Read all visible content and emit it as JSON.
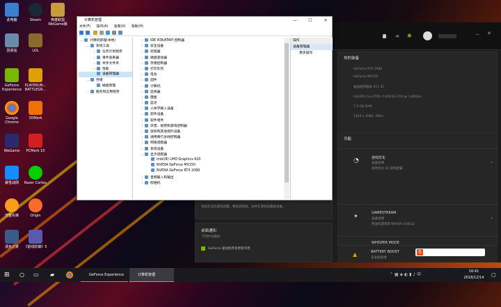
{
  "desktop": {
    "icons": [
      "此电脑",
      "Steam",
      "英雄联盟 WeGame版",
      "回收站",
      "LOL",
      "GeForce Experience",
      "PLAYERUN... BATTLEGR...",
      "Google Chrome",
      "3DMark",
      "WeGame",
      "PCMark 10",
      "暴雪战网",
      "Razer Cortex",
      "守望先锋",
      "Origin",
      "漫步之家",
      "《前线防御》5"
    ]
  },
  "gfe": {
    "section_hot": "热的装备",
    "hw": [
      "GeForce RTX 2080",
      "GeForce MX150",
      "驱动程序版本 417.35",
      "Intel(R) Core(TM) i7-8565U CPU @ 1.80GHz",
      "7.9 GB RAM",
      "1920 x 1080, 59Hz"
    ],
    "section_features": "功能",
    "features": [
      {
        "title": "游戏优化",
        "l1": "准备就绪",
        "l2": "提供优化 42 游戏配置"
      },
      {
        "title": "GAMESTREAM",
        "l1": "准备就绪",
        "l2": "传送的游戏到 NVIDIA SHIELD"
      },
      {
        "title": "WHISPER MODE",
        "l1": "未准备就绪",
        "l2": "请打开，让播放电脑的笔记本电脑更安静地运行。"
      },
      {
        "title": "BATTERY BOOST",
        "l1": "未准备就绪",
        "l2": ""
      }
    ],
    "desc_line": "轻松在您的游戏前瞻，释放游戏帧，合并在游戏前瞻素材素。",
    "notify_title": "桌面通知",
    "notify_sub": "下列时间通知：",
    "notify_check": "GeForce 驱动程序有更新可用"
  },
  "dm": {
    "title": "计算机管理",
    "menu": [
      "文件(F)",
      "操作(A)",
      "查看(V)",
      "帮助(H)"
    ],
    "left": [
      {
        "t": "计算机管理(本地)",
        "lv": 0,
        "ex": "⌄"
      },
      {
        "t": "系统工具",
        "lv": 1,
        "ex": "⌄"
      },
      {
        "t": "任务计划程序",
        "lv": 2,
        "ex": "›"
      },
      {
        "t": "事件查看器",
        "lv": 2,
        "ex": "›"
      },
      {
        "t": "共享文件夹",
        "lv": 2,
        "ex": "›"
      },
      {
        "t": "性能",
        "lv": 2,
        "ex": "›"
      },
      {
        "t": "设备管理器",
        "lv": 2,
        "ex": "",
        "sel": true
      },
      {
        "t": "存储",
        "lv": 1,
        "ex": "⌄"
      },
      {
        "t": "磁盘管理",
        "lv": 2,
        "ex": ""
      },
      {
        "t": "服务和应用程序",
        "lv": 1,
        "ex": "›"
      }
    ],
    "tree": [
      {
        "t": "IDE ATA/ATAPI 控制器",
        "lv": 0,
        "ex": "›"
      },
      {
        "t": "安全设备",
        "lv": 0,
        "ex": "›"
      },
      {
        "t": "处理器",
        "lv": 0,
        "ex": "›"
      },
      {
        "t": "磁盘驱动器",
        "lv": 0,
        "ex": "›"
      },
      {
        "t": "存储控制器",
        "lv": 0,
        "ex": "›"
      },
      {
        "t": "打印队列",
        "lv": 0,
        "ex": "›"
      },
      {
        "t": "电池",
        "lv": 0,
        "ex": "›"
      },
      {
        "t": "固件",
        "lv": 0,
        "ex": "›"
      },
      {
        "t": "计算机",
        "lv": 0,
        "ex": "›"
      },
      {
        "t": "监视器",
        "lv": 0,
        "ex": "›"
      },
      {
        "t": "键盘",
        "lv": 0,
        "ex": "›"
      },
      {
        "t": "蓝牙",
        "lv": 0,
        "ex": "›"
      },
      {
        "t": "人体学输入设备",
        "lv": 0,
        "ex": "›"
      },
      {
        "t": "软件设备",
        "lv": 0,
        "ex": "›"
      },
      {
        "t": "软件组件",
        "lv": 0,
        "ex": "›"
      },
      {
        "t": "声音、视频和游戏控制器",
        "lv": 0,
        "ex": "›"
      },
      {
        "t": "鼠标和其他指针设备",
        "lv": 0,
        "ex": "›"
      },
      {
        "t": "通用串行总线控制器",
        "lv": 0,
        "ex": "›"
      },
      {
        "t": "网络适配器",
        "lv": 0,
        "ex": "›"
      },
      {
        "t": "系统设备",
        "lv": 0,
        "ex": "›"
      },
      {
        "t": "显示适配器",
        "lv": 0,
        "ex": "⌄"
      },
      {
        "t": "Intel(R) UHD Graphics 620",
        "lv": 1,
        "ex": ""
      },
      {
        "t": "NVIDIA GeForce MX150",
        "lv": 1,
        "ex": ""
      },
      {
        "t": "NVIDIA GeForce RTX 2080",
        "lv": 1,
        "ex": ""
      },
      {
        "t": "音频输入和输出",
        "lv": 0,
        "ex": "›"
      },
      {
        "t": "照相机",
        "lv": 0,
        "ex": "›"
      }
    ],
    "actions_header": "操作",
    "actions_sel": "设备管理器",
    "actions_more": "更多操作"
  },
  "taskbar": {
    "items": [
      "GeForce Experience",
      "计算机管理"
    ],
    "time": "16:41",
    "date": "2018/12/14"
  }
}
